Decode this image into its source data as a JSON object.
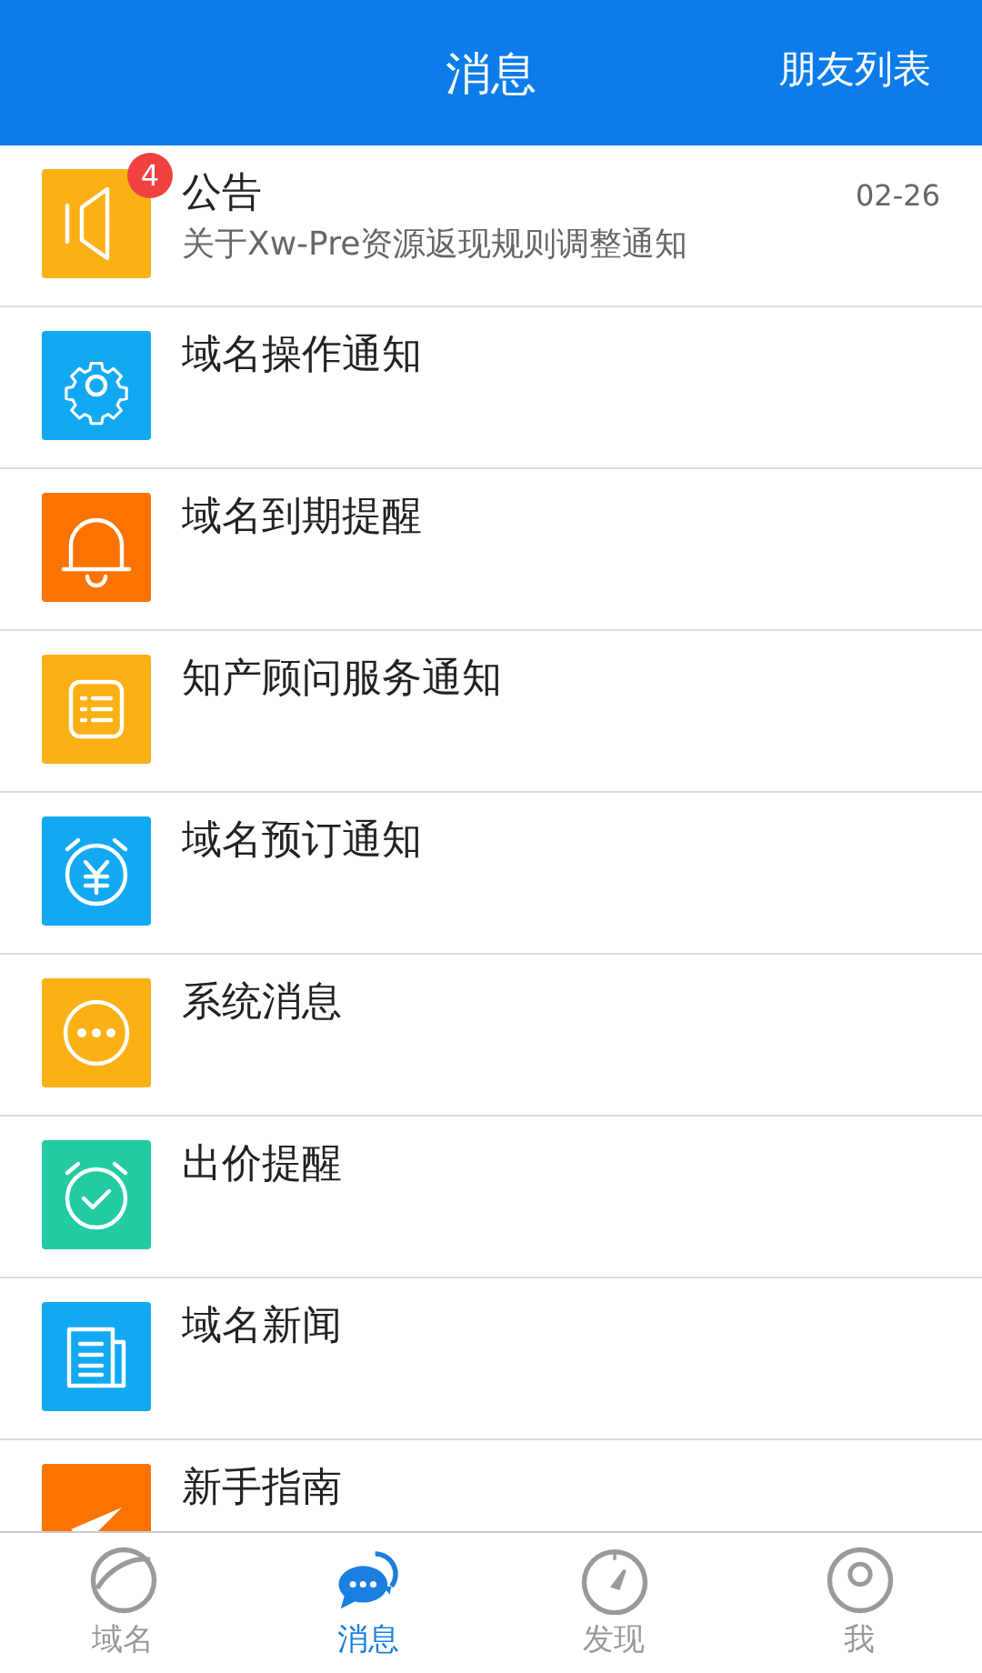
{
  "header": {
    "title": "消息",
    "action": "朋友列表"
  },
  "messages": [
    {
      "kind": "megaphone",
      "color": "#fbb116",
      "title": "公告",
      "badge": "4",
      "time": "02-26",
      "preview": "关于Xw-Pre资源返现规则调整通知"
    },
    {
      "kind": "gear",
      "color": "#12a9f2",
      "title": "域名操作通知"
    },
    {
      "kind": "bell",
      "color": "#fd7301",
      "title": "域名到期提醒"
    },
    {
      "kind": "list",
      "color": "#fbb116",
      "title": "知产顾问服务通知"
    },
    {
      "kind": "alarm-yen",
      "color": "#12a9f2",
      "title": "域名预订通知"
    },
    {
      "kind": "dots",
      "color": "#fbb116",
      "title": "系统消息"
    },
    {
      "kind": "alarm-check",
      "color": "#22cba1",
      "title": "出价提醒"
    },
    {
      "kind": "news",
      "color": "#12a9f2",
      "title": "域名新闻"
    },
    {
      "kind": "send",
      "color": "#fd7301",
      "title": "新手指南"
    }
  ],
  "tabs": [
    {
      "kind": "globe",
      "label": "域名",
      "selected": false
    },
    {
      "kind": "chat",
      "label": "消息",
      "selected": true
    },
    {
      "kind": "compass",
      "label": "发现",
      "selected": false
    },
    {
      "kind": "person",
      "label": "我",
      "selected": false
    }
  ]
}
